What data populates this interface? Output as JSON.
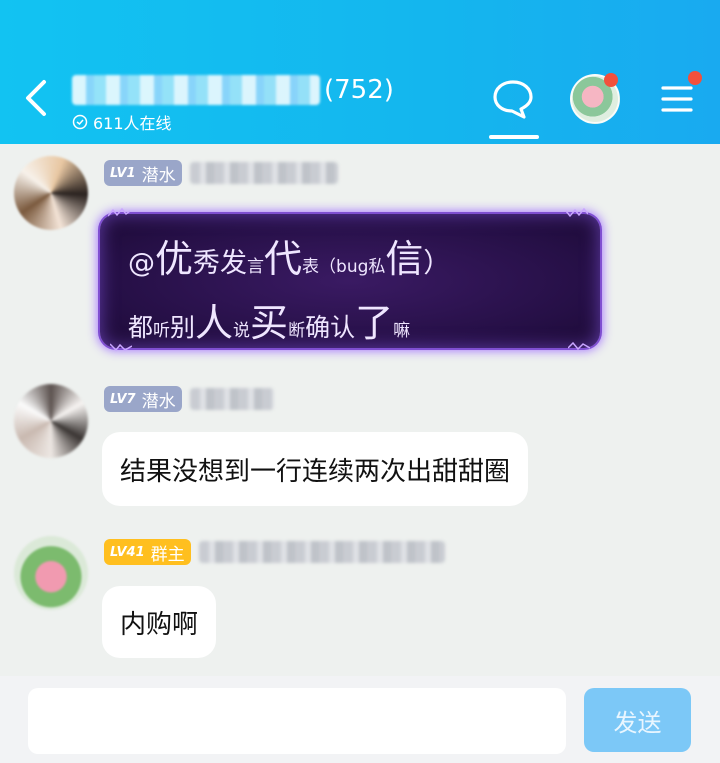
{
  "header": {
    "member_count": "(752)",
    "online_text": "611人在线",
    "accent": "#14b6ee"
  },
  "messages": [
    {
      "level": "LV1",
      "role": "潜水",
      "special_bubble": true,
      "line1": [
        "@",
        "优",
        "秀发",
        "言",
        "代",
        "表（bug私",
        "信",
        "）"
      ],
      "line2": [
        "都",
        "听",
        "别",
        "人",
        "说",
        "买",
        "断",
        "确认",
        "了",
        "嘛"
      ]
    },
    {
      "level": "LV7",
      "role": "潜水",
      "text": "结果没想到一行连续两次出甜甜圈"
    },
    {
      "level": "LV41",
      "role": "群主",
      "text": "内购啊"
    }
  ],
  "composer": {
    "send_label": "发送",
    "send_color": "#7cc8f7"
  },
  "icons": [
    "back-arrow-icon",
    "clock-icon",
    "chat-bubble-icon",
    "menu-icon"
  ]
}
